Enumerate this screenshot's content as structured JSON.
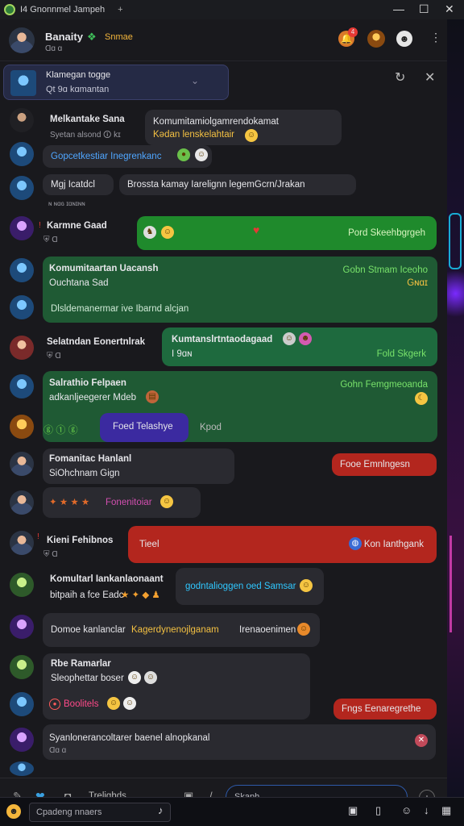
{
  "window": {
    "title": "I4 Gnonnmel Jampeh",
    "tab_plus": "+",
    "min": "—",
    "max": "☐",
    "close": "✕"
  },
  "header": {
    "name": "Banaity",
    "tag": "Snmae",
    "sub": "Ɑɑ ɑ",
    "notif_count": "4"
  },
  "notice": {
    "line1": "Klamegan togge",
    "line2": "Qt 9ɑ kɑmantan"
  },
  "messages": [
    {
      "name": "Melkantake Sana",
      "sub": "Syetan alsond 🛈 kɪ",
      "bubble1": "Komumitamiolgamrendokamat",
      "bubble2": "Kədan lenskelahtair"
    },
    {
      "line": "Gopcetkestiar Inegrenkanc"
    },
    {
      "chip": "Mgj Icatdcl",
      "text": "Brossta kamay Iarelignn legemGcrn/Jrakan",
      "ts": "ɴ ɴɑɢ ɪɑɴɪɴɴ"
    },
    {
      "name": "Karmne Gaad",
      "right": "Pord Skeehbgrgeh"
    },
    {
      "title": "Komumitaartan Uacansh",
      "sub": "Ouchtana Sad",
      "right1": "Gobn Stmam Iceoho",
      "right2": "Gɴɑɪ",
      "bottom": "Dlsldemanermar ive Ibarnd alcjan"
    },
    {
      "name": "Selatndan Eonertnlrak",
      "bubble": "Kumtanslrtntaodagaad",
      "sub": "I 9ɑɴ",
      "right": "Fold Skgerk"
    },
    {
      "name": "Salrathio Felpaen",
      "sub": "adkanljeegerer Mdeb",
      "right": "Gohn Femgmeoanda"
    },
    {
      "pill": "Foed Telashye",
      "extra": "Kpod"
    },
    {
      "name": "Fomanitac Hanlanl",
      "sub": "SiOhchnam Gign",
      "right": "Fooe Emnlngesn"
    },
    {
      "text": "Fonenitoiar"
    },
    {
      "name": "Kieni Fehibnos",
      "bubble": "Tieel",
      "right": "Kon Ianthgank"
    },
    {
      "name": "Komultarl Iankanlaonaant",
      "sub": "bitpaih a fce Eadc",
      "bubble": "godntalioggen oed Samsar"
    },
    {
      "text1": "Domoe kanlanclar",
      "text2": "Kagerdynenojlganam",
      "text3": "Irenaoenimen"
    },
    {
      "name": "Rbe Ramarlar",
      "sub": "Sleophettar boser",
      "btn": "Boolitels",
      "right": "Fngs Eenaregrethe"
    },
    {
      "text": "Syanlonerancoltarer baenel alnopkanal",
      "sub": "Ɑɑ ɑ"
    }
  ],
  "composer": {
    "label": "Trelighds",
    "placeholder": "Skaph"
  },
  "taskbar": {
    "search": "Cpadeng nnaers"
  }
}
